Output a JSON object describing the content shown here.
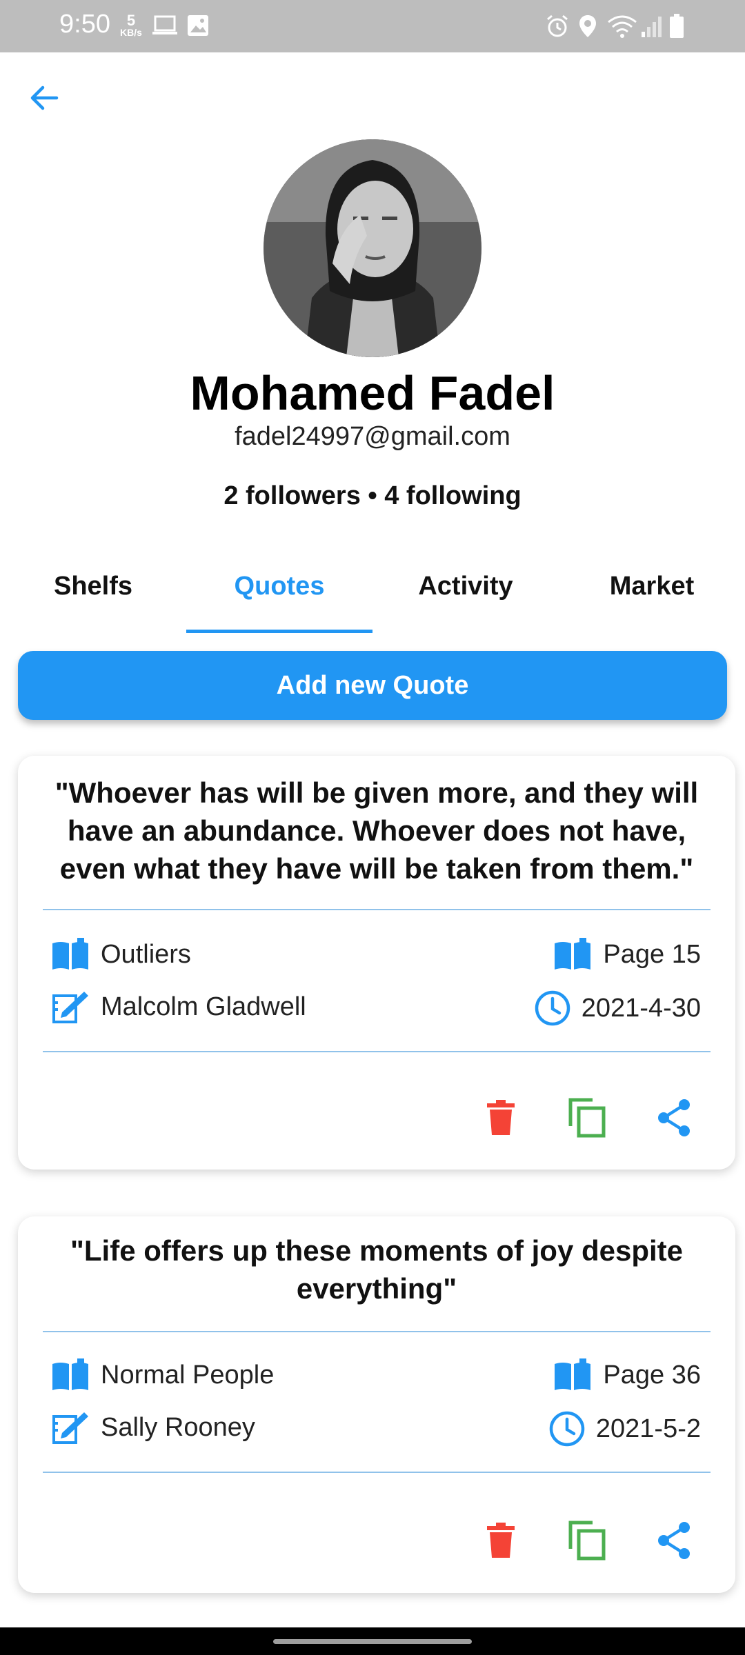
{
  "status_bar": {
    "time": "9:50",
    "speed_value": "5",
    "speed_unit": "KB/s",
    "icons_left": [
      "laptop-icon",
      "image-icon"
    ],
    "icons_right": [
      "alarm-icon",
      "location-icon",
      "wifi-icon",
      "signal-icon",
      "battery-icon"
    ]
  },
  "header": {
    "back_icon": "arrow-back-icon"
  },
  "profile": {
    "name": "Mohamed Fadel",
    "email": "fadel24997@gmail.com",
    "stats": "2 followers • 4 following"
  },
  "tabs": [
    {
      "label": "Shelfs",
      "active": false
    },
    {
      "label": "Quotes",
      "active": true
    },
    {
      "label": "Activity",
      "active": false
    },
    {
      "label": "Market",
      "active": false
    }
  ],
  "add_button_label": "Add new Quote",
  "quotes": [
    {
      "text": "\"Whoever has will be given more, and they will have an abundance. Whoever does not have, even what they have will be taken from them.\"",
      "book": "Outliers",
      "page": "Page 15",
      "author": "Malcolm Gladwell",
      "date": "2021-4-30"
    },
    {
      "text": "\"Life offers up these moments of joy despite everything\"",
      "book": "Normal People",
      "page": "Page 36",
      "author": "Sally Rooney",
      "date": "2021-5-2"
    }
  ],
  "colors": {
    "accent": "#2196f3",
    "delete": "#f44336",
    "copy": "#4caf50",
    "share": "#2196f3",
    "status_bar": "#bdbdbd"
  }
}
